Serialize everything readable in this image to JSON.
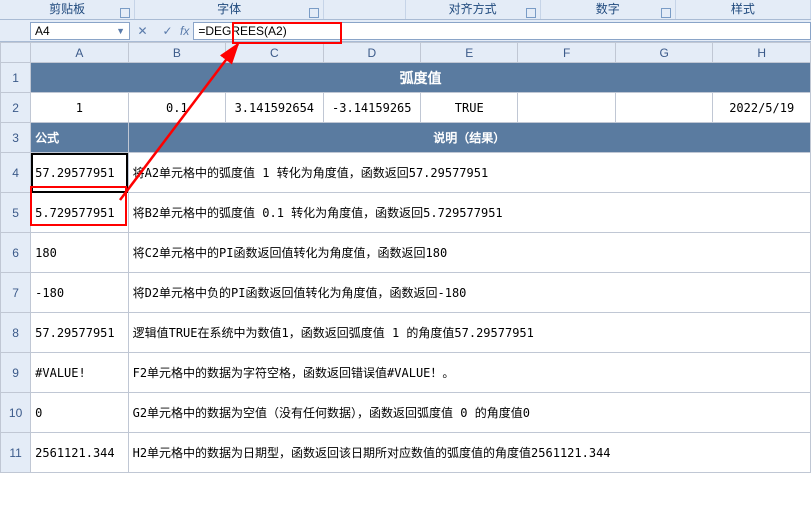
{
  "ribbon": {
    "groups": [
      "剪贴板",
      "字体",
      "",
      "对齐方式",
      "数字",
      "样式"
    ]
  },
  "namebox": {
    "value": "A4"
  },
  "formula_bar": {
    "fx": "fx",
    "value": "=DEGREES(A2)"
  },
  "columns": [
    "A",
    "B",
    "C",
    "D",
    "E",
    "F",
    "G",
    "H"
  ],
  "row_numbers": [
    "1",
    "2",
    "3",
    "4",
    "5",
    "6",
    "7",
    "8",
    "9",
    "10",
    "11"
  ],
  "row1": {
    "title": "弧度值"
  },
  "row2": {
    "A": "1",
    "B": "0.1",
    "C": "3.141592654",
    "D": "-3.14159265",
    "E": "TRUE",
    "F": "",
    "G": "",
    "H": "2022/5/19"
  },
  "row3": {
    "A": "公式",
    "rest": "说明（结果）"
  },
  "rows_data": [
    {
      "A": "57.29577951",
      "desc": "将A2单元格中的弧度值 1 转化为角度值，函数返回57.29577951"
    },
    {
      "A": "5.729577951",
      "desc": "将B2单元格中的弧度值 0.1 转化为角度值，函数返回5.729577951"
    },
    {
      "A": "180",
      "desc": "将C2单元格中的PI函数返回值转化为角度值，函数返回180"
    },
    {
      "A": "-180",
      "desc": "将D2单元格中负的PI函数返回值转化为角度值，函数返回-180"
    },
    {
      "A": "57.29577951",
      "desc": "逻辑值TRUE在系统中为数值1，函数返回弧度值 1 的角度值57.29577951"
    },
    {
      "A": "#VALUE!",
      "desc": "F2单元格中的数据为字符空格，函数返回错误值#VALUE！。"
    },
    {
      "A": "0",
      "desc": "G2单元格中的数据为空值（没有任何数据），函数返回弧度值 0 的角度值0"
    },
    {
      "A": "2561121.344",
      "desc": "H2单元格中的数据为日期型，函数返回该日期所对应数值的弧度值的角度值2561121.344"
    }
  ]
}
